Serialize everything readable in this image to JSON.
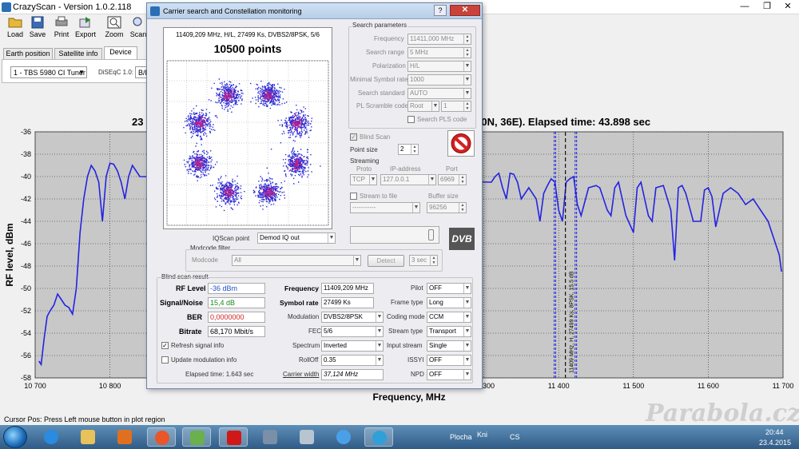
{
  "app": {
    "title": "CrazyScan - Version 1.0.2.118",
    "window_controls": [
      "—",
      "❐",
      "✕"
    ]
  },
  "toolbar": {
    "buttons": [
      "Load",
      "Save",
      "Print",
      "Export",
      "Zoom",
      "Scan"
    ]
  },
  "tabs": [
    "Earth position",
    "Satellite info",
    "Device"
  ],
  "device": {
    "tuner": "1 - TBS 5980 CI Tuner",
    "diseqc_label": "DiSEqC 1.0:",
    "diseqc_value": "B/E"
  },
  "chart": {
    "title_left": "23",
    "title_right": "5 (50N, 36E). Elapsed time: 43.898 sec",
    "marker_label": "11409 MHz, H, 27499 Ks, 8PSK, 15.5 dB"
  },
  "status_bar": "Cursor Pos: Press Left mouse button in plot region",
  "watermark": "Parabola.cz",
  "dialog": {
    "title": "Carrier search and Constellation monitoring",
    "help_btn": "?",
    "close_btn": "✕",
    "constellation": {
      "info": "11409,209 MHz, H/L, 27499 Ks, DVBS2/8PSK, 5/6",
      "points": "10500 points"
    },
    "search_params": {
      "title": "Search parameters",
      "frequency_label": "Frequency",
      "frequency_value": "11411,000 MHz",
      "range_label": "Search range",
      "range_value": "5 MHz",
      "polarization_label": "Polarization",
      "polarization_value": "H/L",
      "min_sr_label": "Minimal Symbol rate",
      "min_sr_value": "1000",
      "standard_label": "Search standard",
      "standard_value": "AUTO",
      "pl_label": "PL Scramble code",
      "pl_value": "Root",
      "pl_num": "1",
      "search_pls": "Search PLS code"
    },
    "blind_scan": "Blind Scan",
    "point_size_label": "Point size",
    "point_size_value": "2",
    "streaming": {
      "title": "Streaming",
      "proto_label": "Proto",
      "ip_label": "IP-address",
      "port_label": "Port",
      "proto_value": "TCP",
      "ip_value": "127.0.0.1",
      "port_value": "6969",
      "stream_to_file": "Stream to file",
      "buffer_label": "Buffer size",
      "file_value": "-----------",
      "buffer_value": "96256"
    },
    "dvb_logo": "DVB",
    "iqscan_label": "IQScan point",
    "iqscan_value": "Demod IQ out",
    "modcode_filter": "Modcode filter",
    "modcode_label": "Modcode",
    "modcode_value": "All",
    "detect_btn": "Detect",
    "detect_time": "3 sec",
    "result": {
      "title": "Blind scan result",
      "rf_label": "RF Level",
      "rf_value": "-36 dBm",
      "sn_label": "Signal/Noise",
      "sn_value": "15,4 dB",
      "ber_label": "BER",
      "ber_value": "0,0000000",
      "bitrate_label": "Bitrate",
      "bitrate_value": "68,170 Mbit/s",
      "freq_label": "Frequency",
      "freq_value": "11409,209 MHz",
      "sr_label": "Symbol rate",
      "sr_value": "27499 Ks",
      "mod_label": "Modulation",
      "mod_value": "DVBS2/8PSK",
      "fec_label": "FEC",
      "fec_value": "5/6",
      "spectrum_label": "Spectrum",
      "spectrum_value": "Inverted",
      "rolloff_label": "RollOff",
      "rolloff_value": "0.35",
      "carrier_width_label": "Carrier width",
      "carrier_width_value": "37,124 MHz",
      "pilot_label": "Pilot",
      "pilot_value": "OFF",
      "frame_label": "Frame type",
      "frame_value": "Long",
      "coding_label": "Coding mode",
      "coding_value": "CCM",
      "stream_type_label": "Stream type",
      "stream_type_value": "Transport",
      "input_label": "Input stream",
      "input_value": "Single",
      "issyi_label": "ISSYI",
      "issyi_value": "OFF",
      "npd_label": "NPD",
      "npd_value": "OFF",
      "refresh_label": "Refresh signal info",
      "update_label": "Update modulation info",
      "elapsed": "Elapsed time: 1.643 sec"
    }
  },
  "chart_data": {
    "type": "line",
    "xlabel": "Frequency, MHz",
    "ylabel": "RF level, dBm",
    "xlim": [
      10700,
      11700
    ],
    "ylim": [
      -58,
      -36
    ],
    "xticks": [
      10700,
      10800,
      10900,
      11000,
      11100,
      11200,
      11300,
      11400,
      11500,
      11600,
      11700
    ],
    "xtick_labels": [
      "10 700",
      "10 800",
      "10 900",
      "11 000",
      "11 100",
      "11 200",
      "11 300",
      "11 400",
      "11 500",
      "11 600",
      "11 700"
    ],
    "yticks": [
      -36,
      -38,
      -40,
      -42,
      -44,
      -46,
      -48,
      -50,
      -52,
      -54,
      -56,
      -58
    ],
    "grid": true,
    "series": [
      {
        "color": "#2424e0",
        "x": [
          10705,
          10708,
          10712,
          10716,
          10720,
          10725,
          10730,
          10735,
          10740,
          10745,
          10750,
          10755,
          10760,
          10765,
          10770,
          10775,
          10780,
          10785,
          10790,
          10795,
          10800,
          10805,
          10810,
          10815,
          10820,
          10825,
          10830,
          10835,
          10840,
          11310,
          11315,
          11320,
          11325,
          11330,
          11335,
          11340,
          11345,
          11350,
          11360,
          11370,
          11375,
          11380,
          11385,
          11390,
          11395,
          11400,
          11405,
          11410,
          11415,
          11420,
          11425,
          11430,
          11440,
          11450,
          11455,
          11460,
          11465,
          11470,
          11475,
          11480,
          11490,
          11500,
          11505,
          11510,
          11515,
          11520,
          11525,
          11530,
          11540,
          11550,
          11555,
          11560,
          11565,
          11570,
          11580,
          11590,
          11595,
          11600,
          11605,
          11610,
          11620,
          11630,
          11640,
          11650,
          11660,
          11670,
          11680,
          11690,
          11695,
          11698
        ],
        "y": [
          -56.5,
          -56.8,
          -54.5,
          -52.5,
          -52.0,
          -51.5,
          -50.5,
          -51.0,
          -51.5,
          -51.7,
          -52.3,
          -50.0,
          -45.0,
          -42.0,
          -40.0,
          -39.0,
          -39.5,
          -40.5,
          -44.0,
          -40.0,
          -38.8,
          -38.9,
          -39.5,
          -40.5,
          -42.0,
          -40.0,
          -39.0,
          -39.5,
          -40.0,
          -40.5,
          -40.0,
          -39.7,
          -41.0,
          -42.0,
          -39.7,
          -39.8,
          -40.5,
          -42.0,
          -41.0,
          -42.0,
          -44.0,
          -41.5,
          -40.8,
          -40.2,
          -40.5,
          -43.0,
          -44.0,
          -40.5,
          -40.2,
          -40.0,
          -42.5,
          -43.5,
          -41.0,
          -40.8,
          -41.0,
          -42.0,
          -43.0,
          -43.5,
          -41.0,
          -40.5,
          -43.5,
          -45.0,
          -41.0,
          -40.5,
          -42.0,
          -43.5,
          -44.0,
          -41.0,
          -40.8,
          -43.0,
          -47.5,
          -41.0,
          -40.8,
          -41.5,
          -44.0,
          -44.0,
          -41.2,
          -41.0,
          -41.8,
          -44.5,
          -41.5,
          -41.0,
          -41.5,
          -42.5,
          -42.0,
          -43.0,
          -44.0,
          -46.0,
          -47.0,
          -48.5
        ]
      }
    ],
    "marker_freq": 11409
  }
}
